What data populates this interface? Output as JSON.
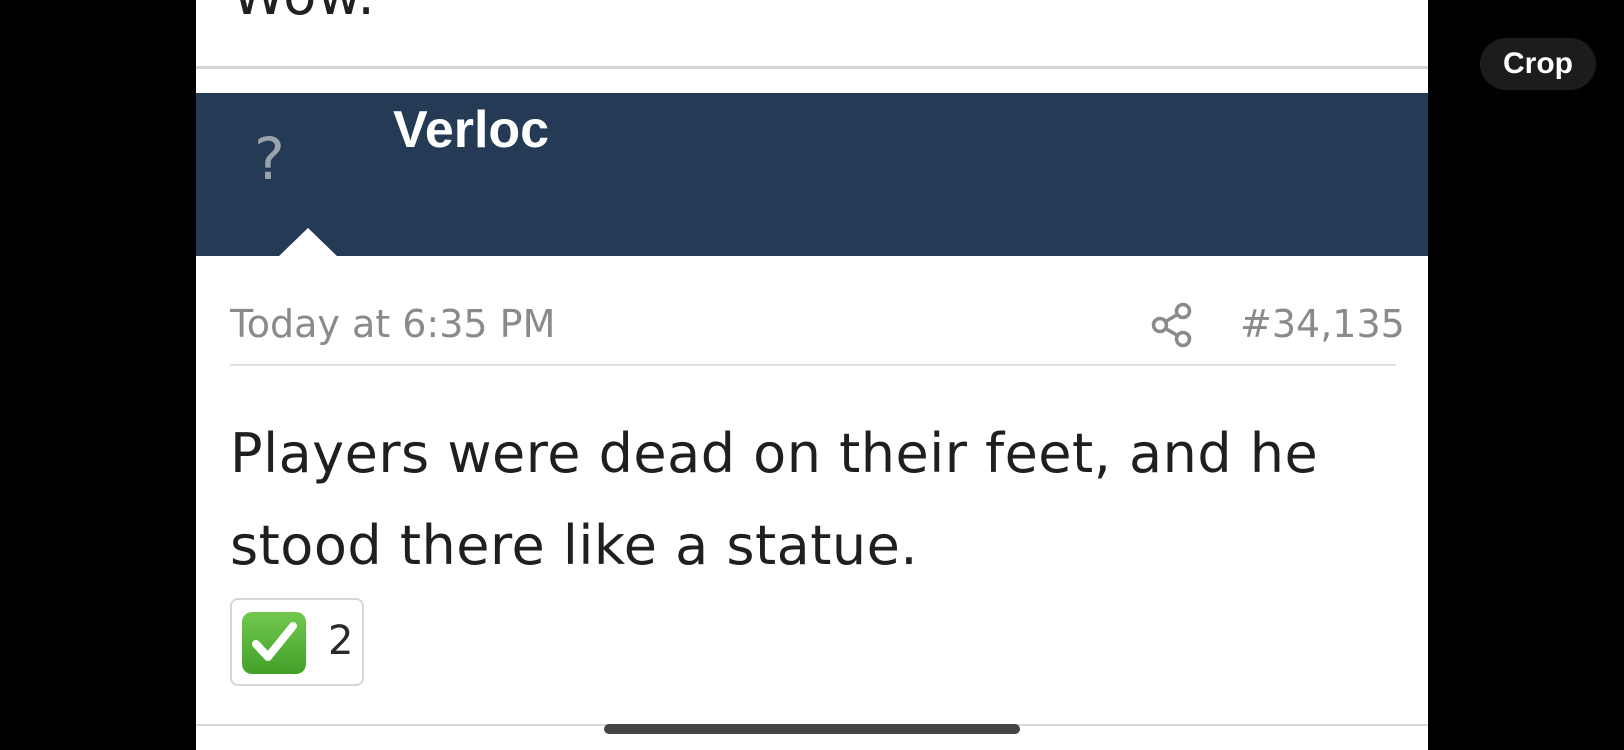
{
  "previous_post": {
    "partial_text": "Wow."
  },
  "post": {
    "author": {
      "name": "Verloc",
      "avatar_placeholder": "?"
    },
    "meta": {
      "date": "Today at 6:35 PM",
      "share_icon": "share-icon",
      "post_number": "#34,135"
    },
    "body": "Players were dead on their feet, and he stood there like a statue.",
    "reaction": {
      "emoji": "white-check-mark-icon",
      "count": "2"
    }
  },
  "overlay": {
    "crop_label": "Crop"
  },
  "colors": {
    "author_bar": "#243a55",
    "meta_text": "#8a8a8a",
    "reaction_green": "#5bb53a"
  }
}
